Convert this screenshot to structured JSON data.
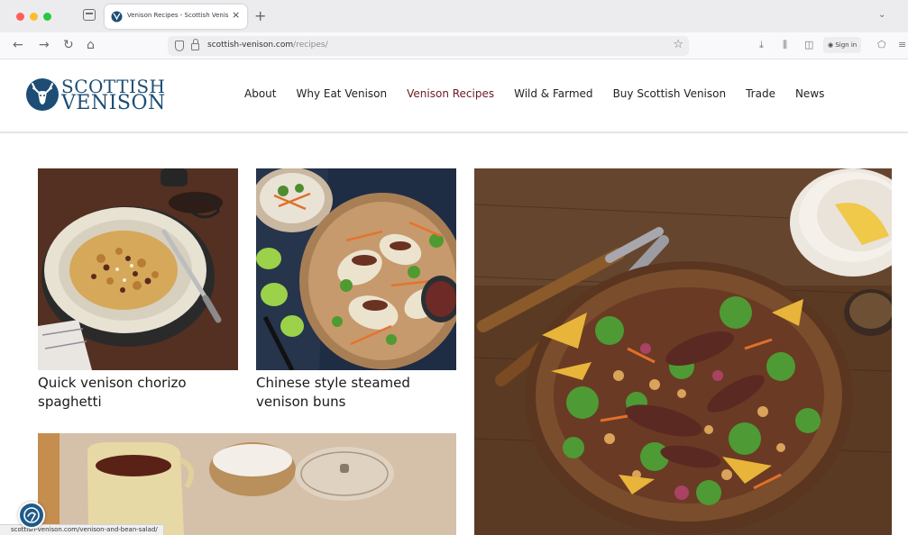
{
  "browser": {
    "tab_title": "Venison Recipes - Scottish Venison",
    "url_domain": "scottish-venison.com",
    "url_path": "/recipes/",
    "sign_in_label": "Sign in",
    "new_tab_label": "+",
    "close_tab_label": "×",
    "tab_list_label": "⌄",
    "back_label": "←",
    "forward_label": "→",
    "reload_label": "↻",
    "home_label": "⌂",
    "bookmark_label": "☆",
    "download_label": "⤓",
    "library_label": "⫼",
    "sidebar_label": "◫",
    "extensions_label": "⬠",
    "menu_label": "≡",
    "status_url": "scottish-venison.com/venison-and-bean-salad/",
    "dot_colors": [
      "#ff5f57",
      "#febc2e",
      "#28c840"
    ]
  },
  "site": {
    "logo_line1": "SCOTTISH",
    "logo_line2": "VENISON",
    "brand_color": "#1d4d74",
    "active_color": "#6b1a24",
    "nav": [
      {
        "label": "About"
      },
      {
        "label": "Why Eat Venison"
      },
      {
        "label": "Venison Recipes"
      },
      {
        "label": "Wild & Farmed"
      },
      {
        "label": "Buy Scottish Venison"
      },
      {
        "label": "Trade"
      },
      {
        "label": "News"
      }
    ],
    "active_nav": "Venison Recipes"
  },
  "recipes": [
    {
      "title_line1": "Quick venison chorizo",
      "title_line2": "spaghetti",
      "image": "spaghetti-bowl"
    },
    {
      "title_line1": "Chinese style steamed",
      "title_line2": "venison buns",
      "image": "steamed-buns-plate"
    },
    {
      "image": "jug-and-bowls"
    },
    {
      "image": "venison-bean-salad"
    }
  ]
}
